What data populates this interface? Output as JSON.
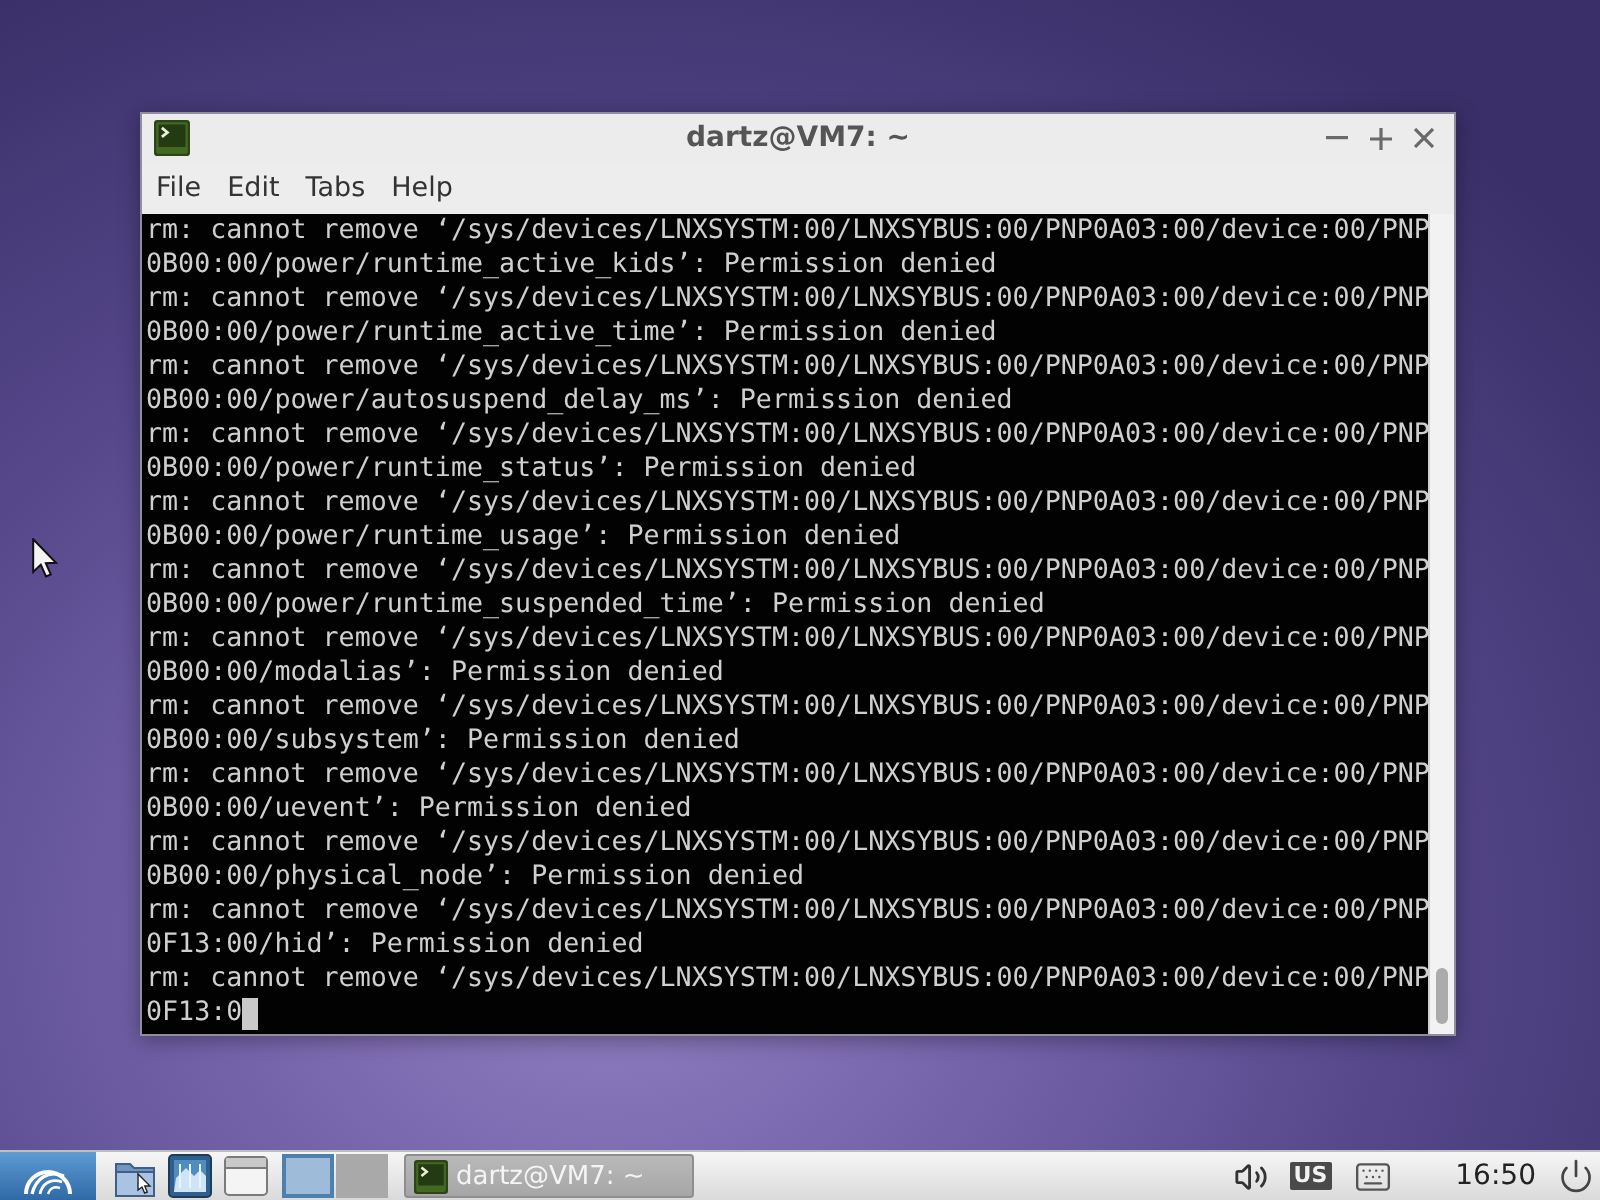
{
  "window": {
    "title": "dartz@VM7: ~",
    "menu": [
      "File",
      "Edit",
      "Tabs",
      "Help"
    ]
  },
  "terminal": {
    "lines": [
      "rm: cannot remove ‘/sys/devices/LNXSYSTM:00/LNXSYBUS:00/PNP0A03:00/device:00/PNP",
      "0B00:00/power/runtime_active_kids’: Permission denied",
      "rm: cannot remove ‘/sys/devices/LNXSYSTM:00/LNXSYBUS:00/PNP0A03:00/device:00/PNP",
      "0B00:00/power/runtime_active_time’: Permission denied",
      "rm: cannot remove ‘/sys/devices/LNXSYSTM:00/LNXSYBUS:00/PNP0A03:00/device:00/PNP",
      "0B00:00/power/autosuspend_delay_ms’: Permission denied",
      "rm: cannot remove ‘/sys/devices/LNXSYSTM:00/LNXSYBUS:00/PNP0A03:00/device:00/PNP",
      "0B00:00/power/runtime_status’: Permission denied",
      "rm: cannot remove ‘/sys/devices/LNXSYSTM:00/LNXSYBUS:00/PNP0A03:00/device:00/PNP",
      "0B00:00/power/runtime_usage’: Permission denied",
      "rm: cannot remove ‘/sys/devices/LNXSYSTM:00/LNXSYBUS:00/PNP0A03:00/device:00/PNP",
      "0B00:00/power/runtime_suspended_time’: Permission denied",
      "rm: cannot remove ‘/sys/devices/LNXSYSTM:00/LNXSYBUS:00/PNP0A03:00/device:00/PNP",
      "0B00:00/modalias’: Permission denied",
      "rm: cannot remove ‘/sys/devices/LNXSYSTM:00/LNXSYBUS:00/PNP0A03:00/device:00/PNP",
      "0B00:00/subsystem’: Permission denied",
      "rm: cannot remove ‘/sys/devices/LNXSYSTM:00/LNXSYBUS:00/PNP0A03:00/device:00/PNP",
      "0B00:00/uevent’: Permission denied",
      "rm: cannot remove ‘/sys/devices/LNXSYSTM:00/LNXSYBUS:00/PNP0A03:00/device:00/PNP",
      "0B00:00/physical_node’: Permission denied",
      "rm: cannot remove ‘/sys/devices/LNXSYSTM:00/LNXSYBUS:00/PNP0A03:00/device:00/PNP",
      "0F13:00/hid’: Permission denied",
      "rm: cannot remove ‘/sys/devices/LNXSYSTM:00/LNXSYBUS:00/PNP0A03:00/device:00/PNP",
      "0F13:0"
    ]
  },
  "taskbar": {
    "workspaces": [
      {
        "selected": true
      },
      {
        "selected": false
      }
    ],
    "tasks": [
      {
        "label": "dartz@VM7: ~",
        "selected": true
      }
    ],
    "keyboard_layout": "US",
    "clock": "16:50"
  }
}
